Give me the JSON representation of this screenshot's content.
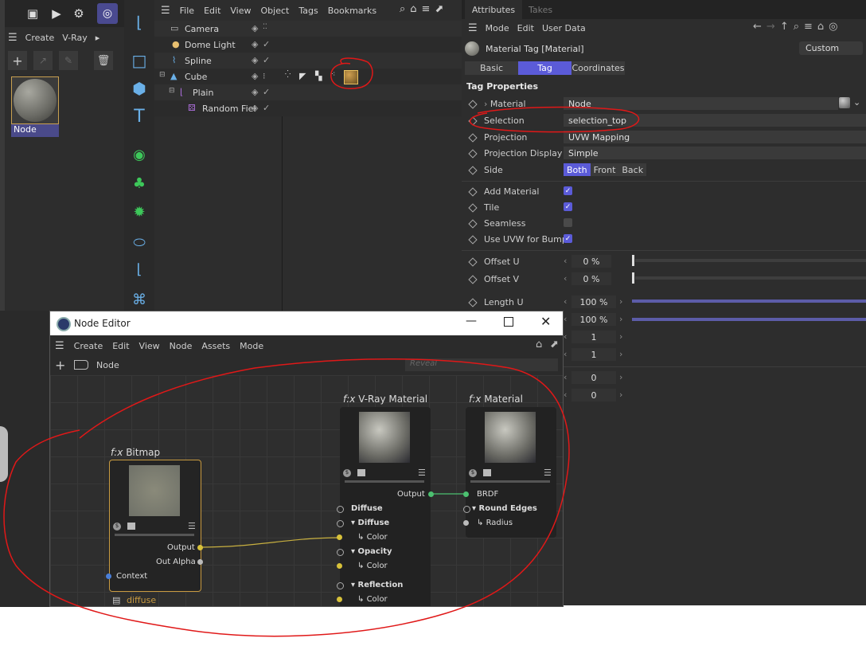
{
  "left_toolbar": {
    "top_icons": [
      "render-region-icon",
      "render-view-icon",
      "render-settings-icon",
      "sphere-mode-icon"
    ]
  },
  "material_manager": {
    "menu": [
      "Create",
      "V-Ray"
    ],
    "material_name": "Node"
  },
  "object_manager": {
    "menu": [
      "File",
      "Edit",
      "View",
      "Object",
      "Tags",
      "Bookmarks"
    ],
    "objects": [
      {
        "name": "Camera",
        "depth": 0
      },
      {
        "name": "Dome Light",
        "depth": 0
      },
      {
        "name": "Spline",
        "depth": 0
      },
      {
        "name": "Cube",
        "depth": 0
      },
      {
        "name": "Plain",
        "depth": 1
      },
      {
        "name": "Random Fiel",
        "depth": 2
      }
    ]
  },
  "attributes": {
    "tabs": [
      "Attributes",
      "Takes"
    ],
    "menu": [
      "Mode",
      "Edit",
      "User Data"
    ],
    "object_title": "Material Tag [Material]",
    "preset": "Custom",
    "subtabs": [
      "Basic",
      "Tag",
      "Coordinates"
    ],
    "active_subtab": "Tag",
    "section": "Tag Properties",
    "material_label": "Material",
    "material_value": "Node",
    "selection_label": "Selection",
    "selection_value": "selection_top",
    "projection_label": "Projection",
    "projection_value": "UVW Mapping",
    "projection_display_label": "Projection Display",
    "projection_display_value": "Simple",
    "side_label": "Side",
    "side_options": [
      "Both",
      "Front",
      "Back"
    ],
    "add_material_label": "Add Material",
    "tile_label": "Tile",
    "seamless_label": "Seamless",
    "use_uvw_label": "Use UVW for Bump",
    "offset_u_label": "Offset U",
    "offset_u_value": "0 %",
    "offset_v_label": "Offset V",
    "offset_v_value": "0 %",
    "length_u_label": "Length U",
    "length_u_value": "100 %",
    "length_v_value": "100 %",
    "tiles_u_value": "1",
    "tiles_v_value": "1",
    "repeat_u_value": "0",
    "repeat_v_value": "0",
    "checks": {
      "add_material": true,
      "tile": true,
      "seamless": false,
      "use_uvw": true
    }
  },
  "node_editor": {
    "title": "Node Editor",
    "menu": [
      "Create",
      "Edit",
      "View",
      "Node",
      "Assets",
      "Mode"
    ],
    "breadcrumb": "Node",
    "search_placeholder": "Reveal",
    "bitmap": {
      "title": "Bitmap",
      "fx": "f:x",
      "outputs": [
        "Output",
        "Out Alpha"
      ],
      "inputs": [
        "Context"
      ],
      "note": "diffuse"
    },
    "vray_material": {
      "title": "V-Ray Material",
      "fx": "f:x",
      "output": "Output",
      "groups": [
        {
          "name": "Diffuse",
          "sub": "Diffuse",
          "port": "Color"
        },
        {
          "name": "",
          "sub": "Opacity",
          "port": "Color"
        },
        {
          "name": "Reflection",
          "sub": "",
          "port": "Color"
        }
      ]
    },
    "material": {
      "title": "Material",
      "fx": "f:x",
      "input": "BRDF",
      "group": "Round Edges",
      "port": "Radius"
    }
  },
  "colors": {
    "accent": "#5b5bd8",
    "annotation": "#e01818",
    "bg": "#2d2d2d",
    "port_yellow": "#d8c23a",
    "port_green": "#4cc070",
    "port_blue": "#4a7fd8"
  }
}
